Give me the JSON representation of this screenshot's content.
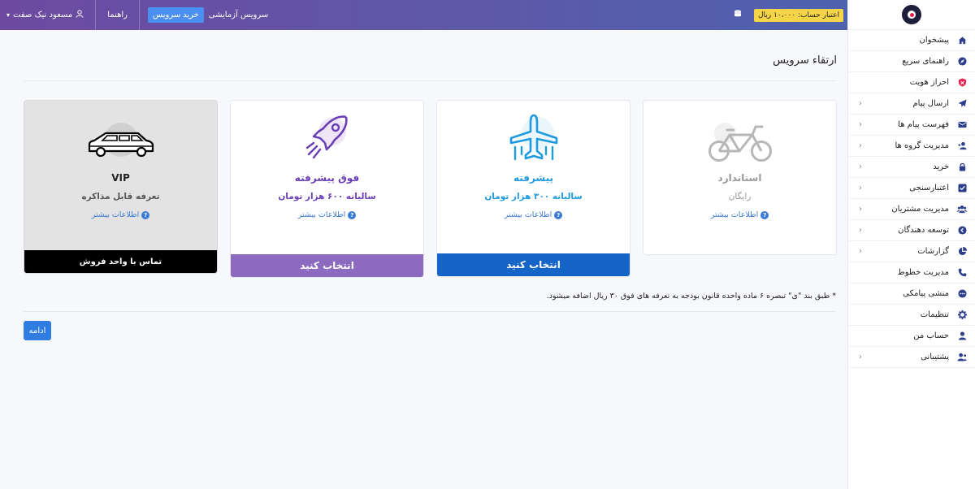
{
  "topbar": {
    "user_name": "مسعود نیک صفت",
    "help": "راهنما",
    "trial_service": "سرویس آزمایشی",
    "buy_service": "خرید سرویس",
    "credit": "اعتبار حساب: ۱۰،۰۰۰ ریال"
  },
  "sidebar": {
    "items": [
      {
        "label": "پیشخوان",
        "icon": "home-icon",
        "chevron": false
      },
      {
        "label": "راهنمای سریع",
        "icon": "compass-icon",
        "chevron": false
      },
      {
        "label": "احراز هویت",
        "icon": "shield-icon",
        "chevron": false
      },
      {
        "label": "ارسال پیام",
        "icon": "paper-plane-icon",
        "chevron": true
      },
      {
        "label": "فهرست پیام ها",
        "icon": "envelope-icon",
        "chevron": true
      },
      {
        "label": "مدیریت گروه ها",
        "icon": "user-plus-icon",
        "chevron": true
      },
      {
        "label": "خرید",
        "icon": "lock-icon",
        "chevron": true
      },
      {
        "label": "اعتبارسنجی",
        "icon": "check-square-icon",
        "chevron": true
      },
      {
        "label": "مدیریت مشتریان",
        "icon": "users-icon",
        "chevron": true
      },
      {
        "label": "توسعه دهندگان",
        "icon": "code-icon",
        "chevron": true
      },
      {
        "label": "گزارشات",
        "icon": "pie-chart-icon",
        "chevron": true
      },
      {
        "label": "مدیریت خطوط",
        "icon": "phone-icon",
        "chevron": false
      },
      {
        "label": "منشی پیامکی",
        "icon": "comment-dots-icon",
        "chevron": false
      },
      {
        "label": "تنظیمات",
        "icon": "gear-icon",
        "chevron": false
      },
      {
        "label": "حساب من",
        "icon": "user-icon",
        "chevron": false
      },
      {
        "label": "پشتیبانی",
        "icon": "user-headset-icon",
        "chevron": true
      }
    ]
  },
  "main": {
    "title": "ارتقاء سرویس",
    "more_info": "اطلاعات بیشتر",
    "plans": {
      "standard": {
        "name": "استاندارد",
        "price": "رایگان",
        "icon": "bicycle-icon"
      },
      "advanced": {
        "name": "پیشرفته",
        "price": "سالیانه ۳۰۰ هزار تومان",
        "button": "انتخاب کنید",
        "icon": "airplane-icon"
      },
      "super": {
        "name": "فوق پیشرفته",
        "price": "سالیانه ۶۰۰ هزار تومان",
        "button": "انتخاب کنید",
        "icon": "rocket-icon"
      },
      "vip": {
        "name": "VIP",
        "price": "تعرفه قابل مذاکره",
        "button": "تماس با واحد فروش",
        "icon": "limousine-icon"
      }
    },
    "note": "* طبق بند \"ی\" تبصره ۶ ماده واحده قانون بودجه به تعرفه های فوق ۳۰ ریال اضافه میشود.",
    "continue": "ادامه"
  },
  "colors": {
    "accent_blue": "#1565c8",
    "accent_purple": "#8b6abf",
    "plan_blue": "#1e9be0",
    "plan_purple": "#6a3fb6",
    "topbar_gradient": [
      "#6c4aa0",
      "#4e62b0"
    ],
    "credit_badge": "#f5d547"
  }
}
